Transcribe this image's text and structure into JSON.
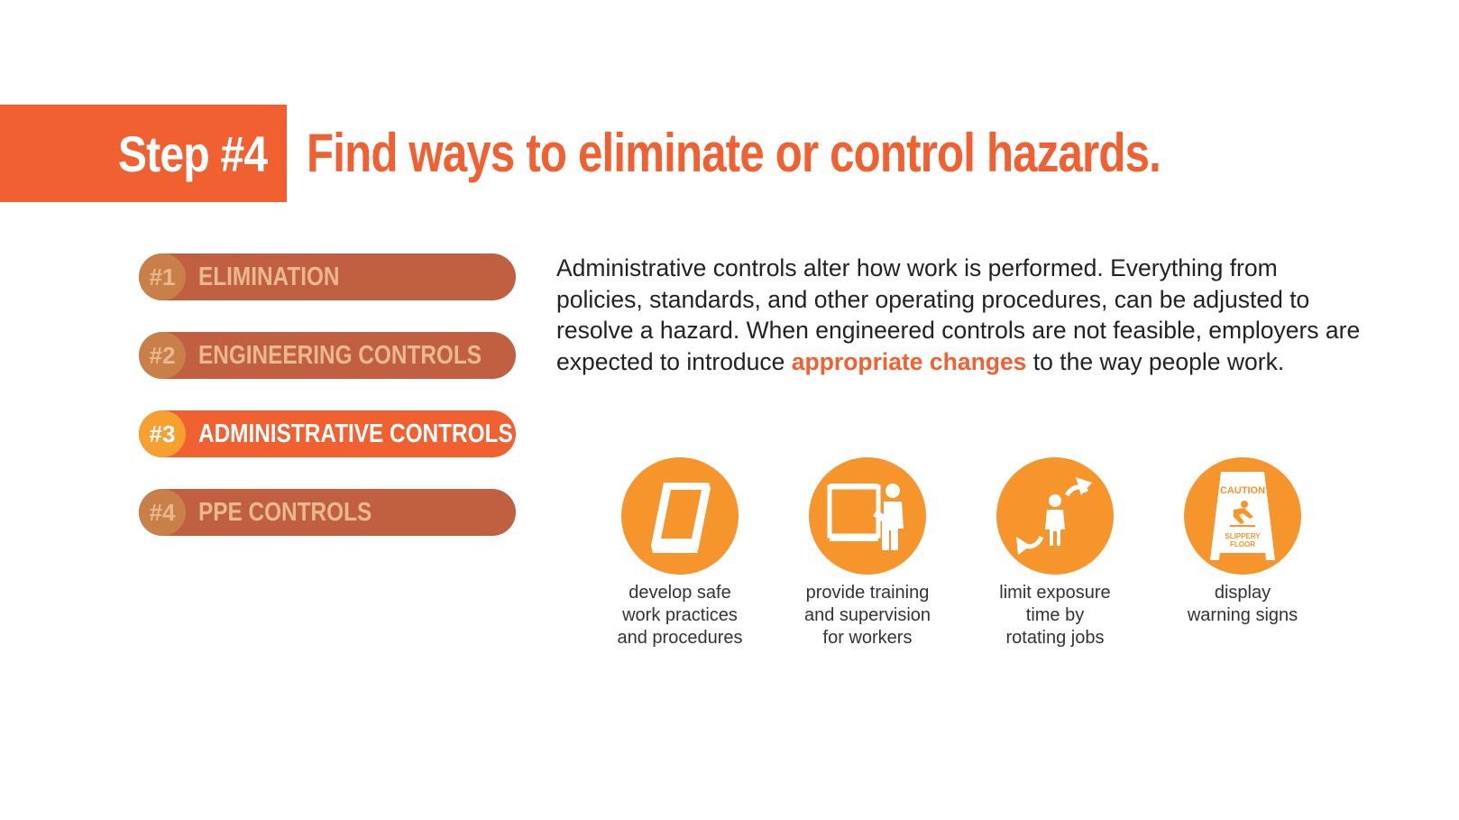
{
  "header": {
    "step": "Step #4",
    "title": "Find ways to eliminate or control hazards."
  },
  "levels": [
    {
      "num": "#1",
      "label": "ELIMINATION",
      "active": false
    },
    {
      "num": "#2",
      "label": "ENGINEERING CONTROLS",
      "active": false
    },
    {
      "num": "#3",
      "label": "ADMINISTRATIVE CONTROLS",
      "active": true
    },
    {
      "num": "#4",
      "label": "PPE CONTROLS",
      "active": false
    }
  ],
  "description": {
    "before": "Administrative controls alter how work is performed. Everything from policies, standards, and other operating procedures, can be adjusted to resolve a hazard. When engineered controls are not feasible, employers are expected to introduce ",
    "highlight": "appropriate changes",
    "after": " to the way people work."
  },
  "items": [
    {
      "icon": "book-icon",
      "lines": [
        "develop safe",
        "work practices",
        "and procedures"
      ]
    },
    {
      "icon": "trainer-whiteboard-icon",
      "lines": [
        "provide training",
        "and supervision",
        "for workers"
      ]
    },
    {
      "icon": "rotation-person-icon",
      "lines": [
        "limit exposure",
        "time by",
        "rotating jobs"
      ]
    },
    {
      "icon": "caution-sign-icon",
      "lines": [
        "display",
        "warning signs"
      ]
    }
  ],
  "sign": {
    "top": "CAUTION",
    "bottom1": "SLIPPERY",
    "bottom2": "FLOOR"
  },
  "colors": {
    "accent": "#f06030",
    "icon_bg": "#f6952c",
    "dim_pill": "#c06040"
  }
}
